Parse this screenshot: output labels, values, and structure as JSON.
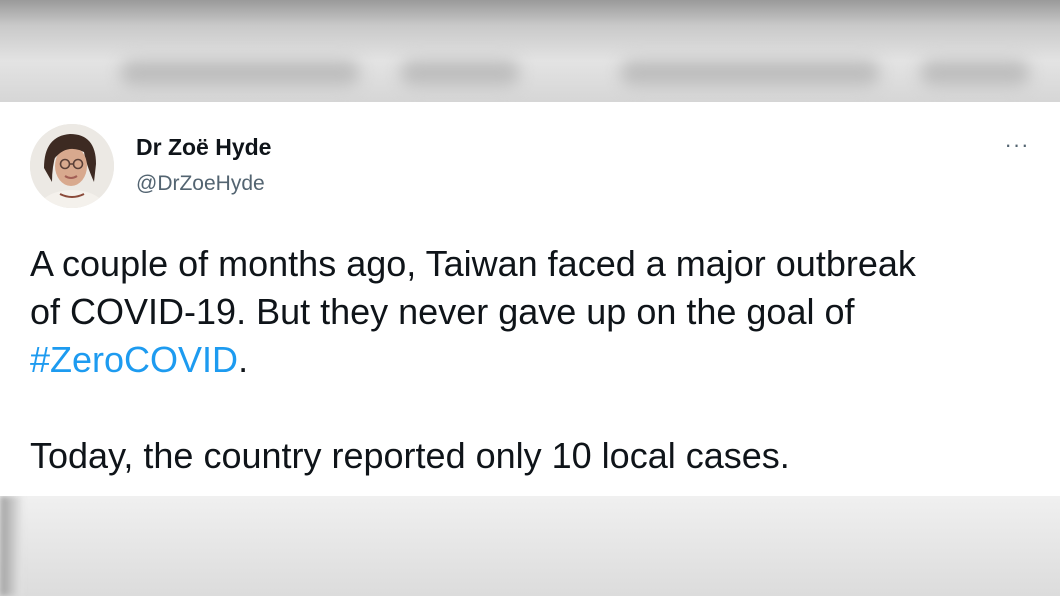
{
  "author": {
    "name": "Dr Zoë Hyde",
    "handle": "@DrZoeHyde"
  },
  "more_menu": {
    "label": "···",
    "icon": "more-horizontal-icon"
  },
  "tweet": {
    "line1": "A couple of months ago, Taiwan faced a major outbreak",
    "line2": "of COVID-19. But they never gave up on the goal of",
    "hashtag": "#ZeroCOVID",
    "hashtag_suffix": ".",
    "paragraph2": "Today, the country reported only 10 local cases."
  },
  "colors": {
    "hashtag": "#1d9bf0",
    "text": "#0f1419",
    "secondary": "#536471",
    "card_bg": "#ffffff"
  }
}
